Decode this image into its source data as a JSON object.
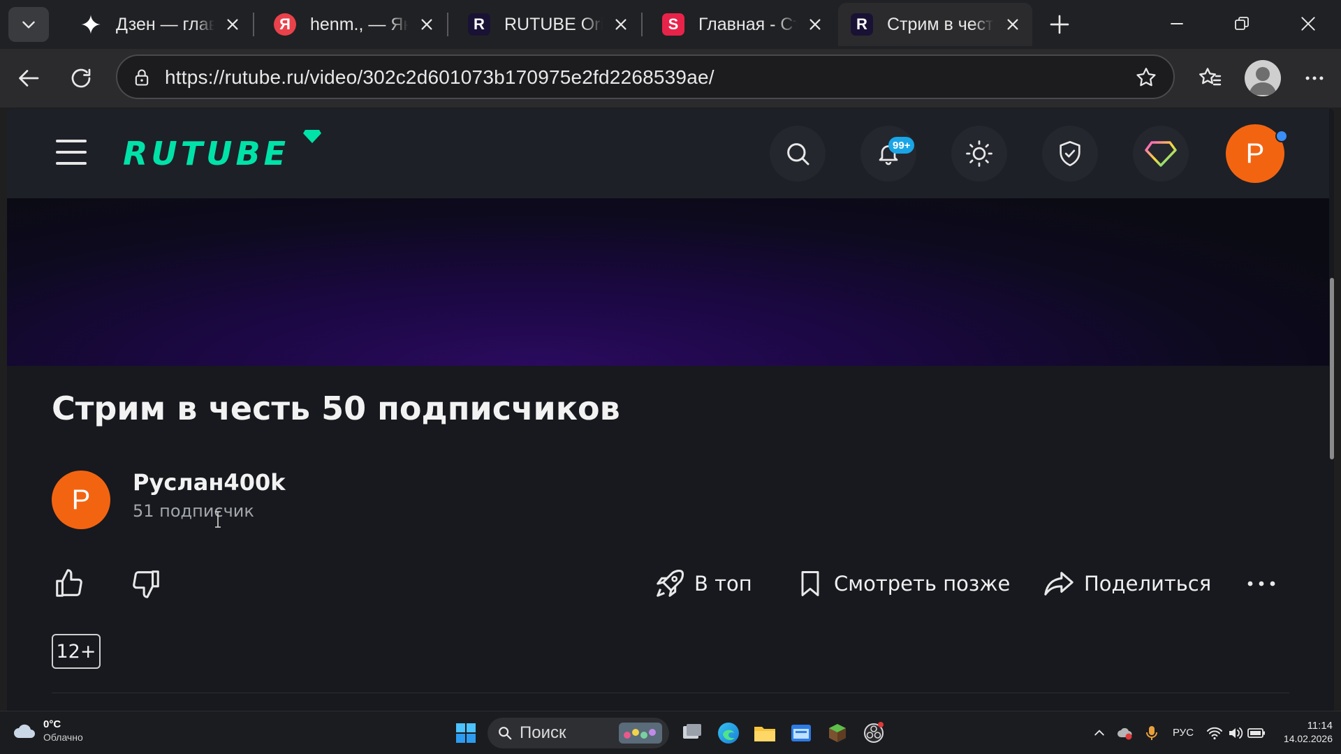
{
  "browser": {
    "tabs": [
      {
        "title": "Дзен — главная",
        "favicon": "sparkle-icon",
        "color": "#202124",
        "active": false
      },
      {
        "title": "henm., — Яндекс",
        "favicon": "yandex-icon",
        "color": "#e9424a",
        "active": false
      },
      {
        "title": "RUTUBE Originals",
        "favicon": "rutube-r-icon",
        "color": "#1a1234",
        "active": false
      },
      {
        "title": "Главная - Студия",
        "favicon": "studio-s-icon",
        "color": "#e8234a",
        "active": false
      },
      {
        "title": "Стрим в честь",
        "favicon": "rutube-r-icon",
        "color": "#1a1234",
        "active": true
      }
    ],
    "favicon_letters": {
      "yandex": "Я",
      "rutube": "R",
      "studio": "S"
    },
    "url": "https://rutube.ru/video/302c2d601073b170975e2fd2268539ae/"
  },
  "rutube": {
    "logo_text": "RUTUBE",
    "notifications_badge": "99+",
    "user_avatar_letter": "Р",
    "accent_color": "#00e2a8",
    "avatar_color": "#f36411"
  },
  "video": {
    "title": "Стрим в честь 50 подписчиков",
    "channel_name": "Руслан400k",
    "channel_subscribers": "51 подписчик",
    "channel_avatar_letter": "Р",
    "actions": {
      "to_top": "В топ",
      "watch_later": "Смотреть позже",
      "share": "Поделиться"
    },
    "age_rating": "12+"
  },
  "taskbar": {
    "weather_temp": "0°C",
    "weather_condition": "Облачно",
    "search_label": "Поиск",
    "language": "РУС",
    "time": "11:14",
    "date": "14.02.2026"
  }
}
